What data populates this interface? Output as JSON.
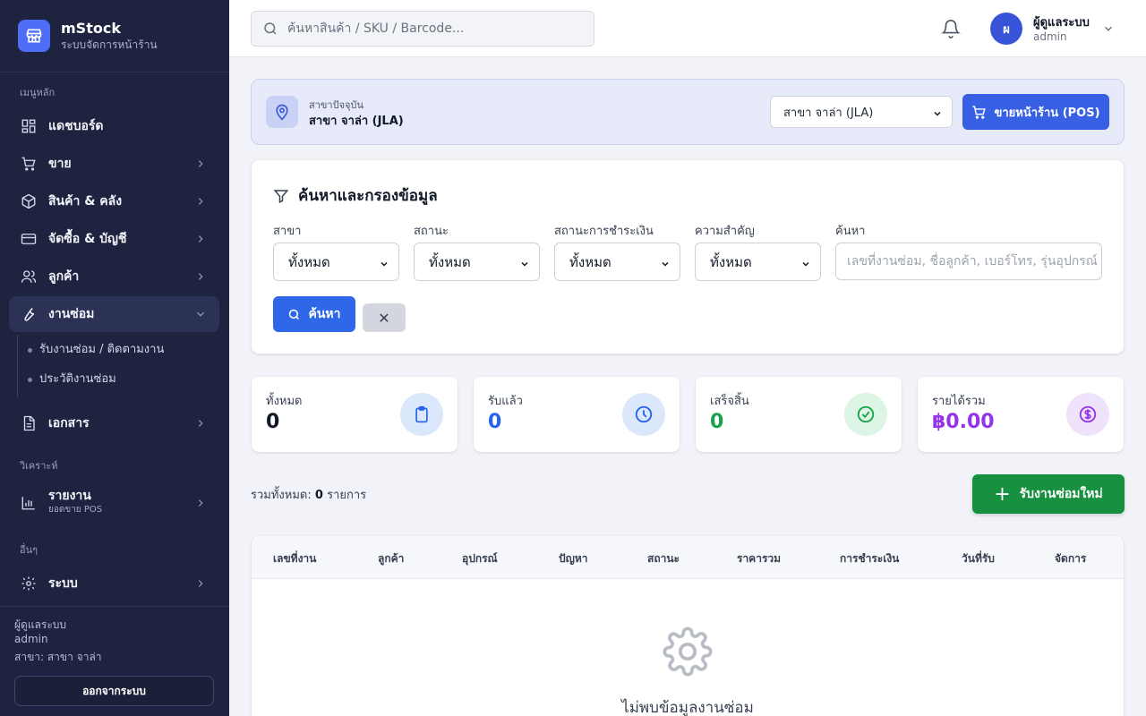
{
  "brand": {
    "name": "mStock",
    "subtitle": "ระบบจัดการหน้าร้าน"
  },
  "sidebar": {
    "section_main": "เมนูหลัก",
    "items": [
      {
        "label": "แดชบอร์ด",
        "icon": "dashboard-icon"
      },
      {
        "label": "ขาย",
        "icon": "cart-icon"
      },
      {
        "label": "สินค้า & คลัง",
        "icon": "box-icon"
      },
      {
        "label": "จัดซื้อ & บัญชี",
        "icon": "card-icon"
      },
      {
        "label": "ลูกค้า",
        "icon": "users-icon"
      },
      {
        "label": "งานซ่อม",
        "icon": "wrench-icon",
        "active": true
      },
      {
        "label": "เอกสาร",
        "icon": "document-icon"
      }
    ],
    "sub_items": [
      "รับงานซ่อม / ติดตามงาน",
      "ประวัติงานซ่อม"
    ],
    "section_analysis": "วิเคราะห์",
    "report": {
      "label": "รายงาน",
      "sub": "ยอดขาย POS"
    },
    "section_other": "อื่นๆ",
    "system": {
      "label": "ระบบ"
    },
    "footer": {
      "user": "ผู้ดูแลระบบ",
      "role": "admin",
      "branch": "สาขา: สาขา จาล่า",
      "logout": "ออกจากระบบ"
    }
  },
  "topbar": {
    "search_placeholder": "ค้นหาสินค้า / SKU / Barcode...",
    "avatar_initial": "ผ",
    "user_name": "ผู้ดูแลระบบ",
    "user_role": "admin"
  },
  "branch": {
    "label": "สาขาปัจจุบัน",
    "name": "สาขา จาล่า (JLA)",
    "selected": "สาขา จาล่า (JLA)",
    "pos_button": "ขายหน้าร้าน (POS)"
  },
  "filter": {
    "title": "ค้นหาและกรองข้อมูล",
    "fields": [
      {
        "label": "สาขา",
        "value": "ทั้งหมด"
      },
      {
        "label": "สถานะ",
        "value": "ทั้งหมด"
      },
      {
        "label": "สถานะการชำระเงิน",
        "value": "ทั้งหมด"
      },
      {
        "label": "ความสำคัญ",
        "value": "ทั้งหมด"
      }
    ],
    "search_label": "ค้นหา",
    "search_placeholder": "เลขที่งานซ่อม, ชื่อลูกค้า, เบอร์โทร, รุ่นอุปกรณ์",
    "search_button": "ค้นหา",
    "clear_button": "✕"
  },
  "stats": [
    {
      "label": "ทั้งหมด",
      "value": "0",
      "color": "#111827",
      "icon": "clipboard-icon",
      "icon_bg": "#dbe7fb",
      "icon_color": "#2563eb"
    },
    {
      "label": "รับแล้ว",
      "value": "0",
      "color": "#2563eb",
      "icon": "clock-icon",
      "icon_bg": "#dbe7fb",
      "icon_color": "#2563eb"
    },
    {
      "label": "เสร็จสิ้น",
      "value": "0",
      "color": "#16a34a",
      "icon": "check-circle-icon",
      "icon_bg": "#dcf5e4",
      "icon_color": "#16a34a"
    },
    {
      "label": "รายได้รวม",
      "value": "฿0.00",
      "color": "#9333ea",
      "icon": "dollar-icon",
      "icon_bg": "#efe3fb",
      "icon_color": "#9333ea"
    }
  ],
  "summary": {
    "prefix": "รวมทั้งหมด:",
    "count": "0",
    "suffix": "รายการ"
  },
  "new_button": "รับงานซ่อมใหม่",
  "table": {
    "headers": [
      "เลขที่งาน",
      "ลูกค้า",
      "อุปกรณ์",
      "ปัญหา",
      "สถานะ",
      "ราคารวม",
      "การชำระเงิน",
      "วันที่รับ",
      "จัดการ"
    ],
    "empty_text": "ไม่พบข้อมูลงานซ่อม"
  }
}
